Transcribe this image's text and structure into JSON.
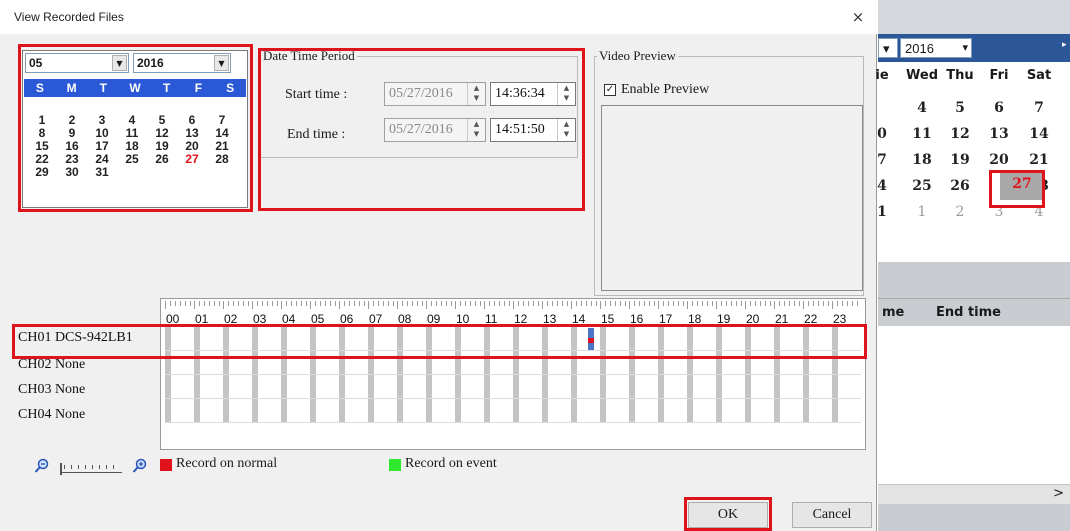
{
  "dialog": {
    "title": "View Recorded Files",
    "close_glyph": "×"
  },
  "calendar": {
    "month": "05",
    "year": "2016",
    "weekdays": [
      "S",
      "M",
      "T",
      "W",
      "T",
      "F",
      "S"
    ],
    "days": [
      "",
      "",
      "",
      "",
      "",
      "",
      "",
      "1",
      "2",
      "3",
      "4",
      "5",
      "6",
      "7",
      "8",
      "9",
      "10",
      "11",
      "12",
      "13",
      "14",
      "15",
      "16",
      "17",
      "18",
      "19",
      "20",
      "21",
      "22",
      "23",
      "24",
      "25",
      "26",
      "27",
      "28",
      "29",
      "30",
      "31",
      "",
      "",
      "",
      ""
    ],
    "today": "27"
  },
  "period": {
    "legend": "Date Time Period",
    "start_label": "Start time :",
    "start_date": "05/27/2016",
    "start_time": "14:36:34",
    "end_label": "End time :",
    "end_date": "05/27/2016",
    "end_time": "14:51:50"
  },
  "preview": {
    "legend": "Video Preview",
    "enable_label": "Enable Preview",
    "enable_checked": true,
    "check_glyph": "✓"
  },
  "timeline": {
    "hours": [
      "00",
      "01",
      "02",
      "03",
      "04",
      "05",
      "06",
      "07",
      "08",
      "09",
      "10",
      "11",
      "12",
      "13",
      "14",
      "15",
      "16",
      "17",
      "18",
      "19",
      "20",
      "21",
      "22",
      "23"
    ],
    "recording_hour": 14.6
  },
  "channels": [
    {
      "label": "CH01 DCS-942LB1"
    },
    {
      "label": "CH02 None"
    },
    {
      "label": "CH03 None"
    },
    {
      "label": "CH04 None"
    }
  ],
  "legend": {
    "normal_label": "Record on normal",
    "normal_color": "#e0121b",
    "event_label": "Record on event",
    "event_color": "#2ee82e"
  },
  "icons": {
    "zoom_out": "zoom-out-icon",
    "zoom_in": "zoom-in-icon"
  },
  "buttons": {
    "ok": "OK",
    "cancel": "Cancel"
  },
  "background_window": {
    "month_glyph": "▾",
    "year": "2016",
    "weekdays": [
      "ie",
      "Wed",
      "Thu",
      "Fri",
      "Sat"
    ],
    "rows": [
      [
        "",
        "4",
        "5",
        "6",
        "7"
      ],
      [
        "0",
        "11",
        "12",
        "13",
        "14"
      ],
      [
        "7",
        "18",
        "19",
        "20",
        "21"
      ],
      [
        "4",
        "25",
        "26",
        "27",
        "28"
      ],
      [
        "1",
        "1",
        "2",
        "3",
        "4"
      ]
    ],
    "col_time": "me",
    "col_end": "End time",
    "scroll_glyph": ">"
  }
}
